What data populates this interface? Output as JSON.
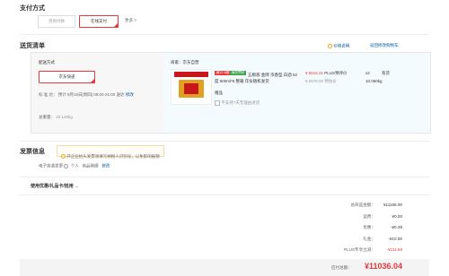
{
  "payment": {
    "title": "支付方式",
    "options": [
      {
        "label": "货到付款",
        "selected": false
      },
      {
        "label": "在线支付",
        "selected": true
      }
    ],
    "more_label": "更多"
  },
  "delivery": {
    "title": "送货清单",
    "price_note": "价格说明",
    "cart_link": "返回修改购物车",
    "method_label": "配送方式",
    "method_option": "京东快递",
    "ship_time_label": "标 准 达：",
    "ship_time": "预计 8月15日[周四] 09:00-21:00 送达",
    "ship_time_edit": "修改",
    "weight_label": "总重量：",
    "weight_value": "20.120kg",
    "seller": "商家：京东自营",
    "item": {
      "tags": [
        "满12.8减",
        "清仓特价"
      ],
      "title": "五粮液 金牌 浓香型 白酒 52度 500ml*6 整箱 年份随机发货",
      "price": "¥ 5516.21",
      "plus_label": "PLUS预评价",
      "sub_price": "¥ 5576.00 预估价",
      "qty": "x2",
      "stock": "有货",
      "weight": "10.060kg",
      "gift_label": "赠品",
      "service_note": "不支持7天无理由退货"
    }
  },
  "invoice": {
    "title": "发票信息",
    "notice": "开企业抬头发票须填写纳税人识别号，以免影响报销",
    "type": "电子普通发票",
    "holder": "个人",
    "content": "商品明细",
    "edit": "修改"
  },
  "coupon": {
    "title": "使用优惠/礼品卡/抵用"
  },
  "summary": {
    "rows": [
      {
        "label": "总商品金额：",
        "value": "¥11158.00",
        "red": false
      },
      {
        "label": "运费：",
        "value": "¥0.00",
        "red": false
      },
      {
        "label": "优惠：",
        "value": "-¥0.38",
        "red": false
      },
      {
        "label": "礼金：",
        "value": "-¥10.00",
        "red": false
      },
      {
        "label": "PLUS专享立减：",
        "value": "-¥111.58",
        "red": true
      }
    ],
    "payable_label": "应付总额：",
    "payable_value": "¥11036.04"
  },
  "colors": {
    "accent": "#e4393c",
    "link": "#005aa0",
    "panel_bg": "#f3fbfe",
    "panel_left_bg": "#f7f7f7"
  }
}
